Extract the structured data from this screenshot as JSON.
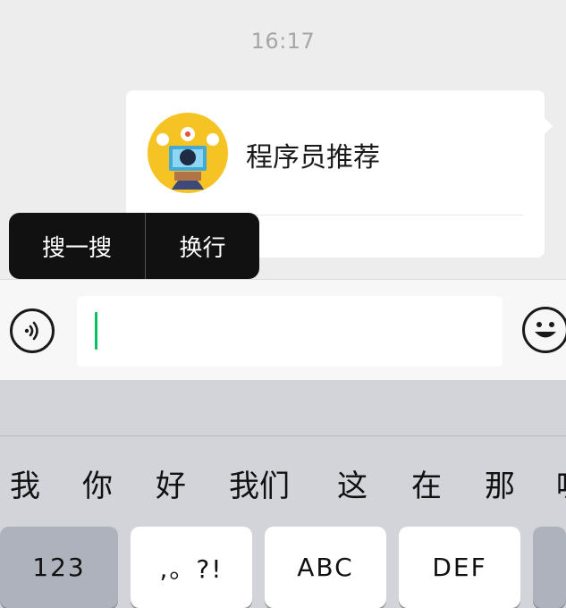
{
  "chat": {
    "time": "16:17",
    "card": {
      "title": "程序员推荐"
    }
  },
  "context_menu": {
    "search_label": "搜一搜",
    "newline_label": "换行"
  },
  "input_bar": {
    "text_value": "",
    "voice_icon": "voice-icon",
    "emoji_icon": "emoji-icon",
    "cursor_color": "#07c160"
  },
  "keyboard": {
    "candidates": [
      "我",
      "你",
      "好",
      "我们",
      "这",
      "在",
      "那",
      "呢"
    ],
    "keys": {
      "numbers": "123",
      "punct": ",。?!",
      "abc": "ABC",
      "def": "DEF"
    }
  }
}
